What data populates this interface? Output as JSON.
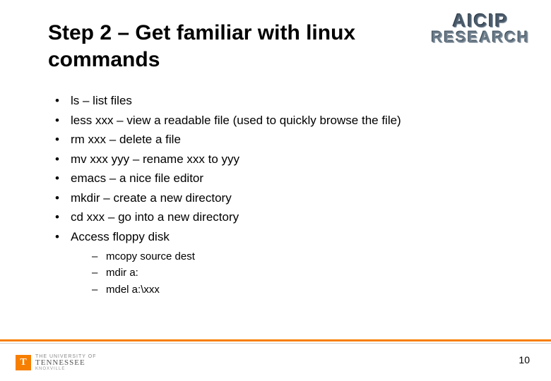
{
  "header": {
    "logo_line1": "AICIP",
    "logo_line2": "RESEARCH"
  },
  "title": "Step 2 – Get familiar with linux commands",
  "bullets": [
    "ls – list files",
    "less xxx – view a readable file (used to quickly browse the file)",
    "rm xxx – delete a file",
    "mv xxx yyy – rename xxx to yyy",
    "emacs – a nice file editor",
    "mkdir – create a new directory",
    "cd xxx – go into a new directory",
    "Access floppy disk"
  ],
  "sub_bullets": [
    "mcopy source dest",
    "mdir a:",
    "mdel a:\\xxx"
  ],
  "footer": {
    "ut_mark": "T",
    "ut_line1": "THE UNIVERSITY OF",
    "ut_line2": "TENNESSEE",
    "ut_line3": "KNOXVILLE",
    "page_number": "10"
  }
}
